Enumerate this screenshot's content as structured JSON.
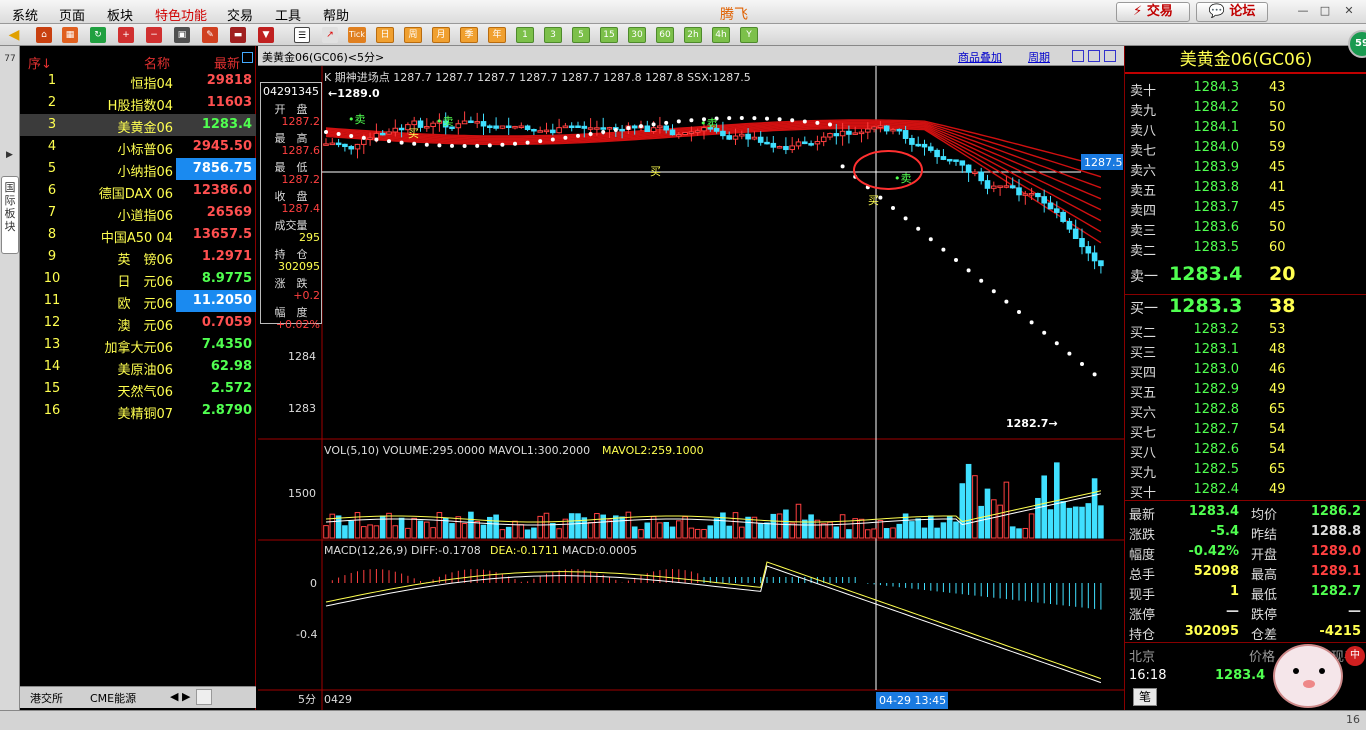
{
  "menu": {
    "items": [
      "系统",
      "页面",
      "板块",
      "特色功能",
      "交易",
      "工具",
      "帮助"
    ],
    "app_title": "腾飞",
    "trade_btn": "交易",
    "forum_btn": "论坛",
    "win_controls": [
      "—",
      "□",
      "✕"
    ]
  },
  "toolbar": {
    "periods": [
      "日",
      "周",
      "月",
      "季",
      "年",
      "1",
      "3",
      "5",
      "15",
      "30",
      "60",
      "2h",
      "4h",
      "Y"
    ],
    "tick_label": "Tick"
  },
  "left_tab": {
    "label": "国际板块",
    "top_label": "77"
  },
  "watchlist": {
    "headers": {
      "no": "序↓",
      "name": "名称",
      "price": "最新"
    },
    "rows": [
      {
        "no": "1",
        "name": "恒指04",
        "price": "29818",
        "color": "red"
      },
      {
        "no": "2",
        "name": "H股指数04",
        "price": "11603",
        "color": "red"
      },
      {
        "no": "3",
        "name": "美黄金06",
        "price": "1283.4",
        "color": "green",
        "selected": true
      },
      {
        "no": "4",
        "name": "小标普06",
        "price": "2945.50",
        "color": "red"
      },
      {
        "no": "5",
        "name": "小纳指06",
        "price": "7856.75",
        "color": "hl"
      },
      {
        "no": "6",
        "name": "德国DAX 06",
        "price": "12386.0",
        "color": "red"
      },
      {
        "no": "7",
        "name": "小道指06",
        "price": "26569",
        "color": "red"
      },
      {
        "no": "8",
        "name": "中国A50 04",
        "price": "13657.5",
        "color": "red"
      },
      {
        "no": "9",
        "name": "英　镑06",
        "price": "1.2971",
        "color": "red"
      },
      {
        "no": "10",
        "name": "日　元06",
        "price": "8.9775",
        "color": "green"
      },
      {
        "no": "11",
        "name": "欧　元06",
        "price": "11.2050",
        "color": "hl"
      },
      {
        "no": "12",
        "name": "澳　元06",
        "price": "0.7059",
        "color": "red"
      },
      {
        "no": "13",
        "name": "加拿大元06",
        "price": "7.4350",
        "color": "green"
      },
      {
        "no": "14",
        "name": "美原油06",
        "price": "62.98",
        "color": "green"
      },
      {
        "no": "15",
        "name": "天然气06",
        "price": "2.572",
        "color": "green"
      },
      {
        "no": "16",
        "name": "美精铜07",
        "price": "2.8790",
        "color": "green"
      }
    ],
    "footer_tabs": [
      "港交所",
      "CME能源"
    ]
  },
  "chart_header": {
    "title": "美黄金06(GC06)<5分>",
    "overlay_link": "商品叠加",
    "period_link": "周期"
  },
  "kline": {
    "indicator_label": "K  期神进场点  1287.7  1287.7  1287.7  1287.7  1287.7  1287.8  1287.8  SSX:1287.5",
    "high_marker": "1289.0",
    "low_marker": "1282.7",
    "price_tag": "1287.5",
    "y_ticks": [
      "1284",
      "1283"
    ],
    "signal_sell": "卖",
    "signal_buy": "买"
  },
  "infobox": {
    "time": "04291345",
    "labels": [
      "开　盘",
      "最　高",
      "最　低",
      "收　盘",
      "成交量",
      "持　仓",
      "涨　跌",
      "幅　度"
    ],
    "values": [
      "1287.2",
      "1287.6",
      "1287.2",
      "1287.4",
      "295",
      "302095",
      "+0.2",
      "+0.02%"
    ]
  },
  "volume": {
    "label": "VOL(5,10)  VOLUME:295.0000  MAVOL1:300.2000",
    "label2": "MAVOL2:259.1000",
    "y_tick": "1500"
  },
  "macd": {
    "label": "MACD(12,26,9)  DIFF:-0.1708",
    "dea": "DEA:-0.1711",
    "macd_val": "MACD:0.0005",
    "y_ticks": [
      "0",
      "-0.4"
    ]
  },
  "xaxis": {
    "period": "5分",
    "start": "0429",
    "cursor_time": "04-29 13:45"
  },
  "orderbook": {
    "title": "美黄金06(GC06)",
    "asks": [
      {
        "label": "卖十",
        "price": "1284.3",
        "vol": "43"
      },
      {
        "label": "卖九",
        "price": "1284.2",
        "vol": "50"
      },
      {
        "label": "卖八",
        "price": "1284.1",
        "vol": "50"
      },
      {
        "label": "卖七",
        "price": "1284.0",
        "vol": "59"
      },
      {
        "label": "卖六",
        "price": "1283.9",
        "vol": "45"
      },
      {
        "label": "卖五",
        "price": "1283.8",
        "vol": "41"
      },
      {
        "label": "卖四",
        "price": "1283.7",
        "vol": "45"
      },
      {
        "label": "卖三",
        "price": "1283.6",
        "vol": "50"
      },
      {
        "label": "卖二",
        "price": "1283.5",
        "vol": "60"
      },
      {
        "label": "卖一",
        "price": "1283.4",
        "vol": "20"
      }
    ],
    "bids": [
      {
        "label": "买一",
        "price": "1283.3",
        "vol": "38"
      },
      {
        "label": "买二",
        "price": "1283.2",
        "vol": "53"
      },
      {
        "label": "买三",
        "price": "1283.1",
        "vol": "48"
      },
      {
        "label": "买四",
        "price": "1283.0",
        "vol": "46"
      },
      {
        "label": "买五",
        "price": "1282.9",
        "vol": "49"
      },
      {
        "label": "买六",
        "price": "1282.8",
        "vol": "65"
      },
      {
        "label": "买七",
        "price": "1282.7",
        "vol": "54"
      },
      {
        "label": "买八",
        "price": "1282.6",
        "vol": "54"
      },
      {
        "label": "买九",
        "price": "1282.5",
        "vol": "65"
      },
      {
        "label": "买十",
        "price": "1282.4",
        "vol": "49"
      }
    ],
    "stats": [
      {
        "k1": "最新",
        "v1": "1283.4",
        "c1": "green",
        "k2": "均价",
        "v2": "1286.2",
        "c2": "green"
      },
      {
        "k1": "涨跌",
        "v1": "-5.4",
        "c1": "green",
        "k2": "昨结",
        "v2": "1288.8",
        "c2": "white"
      },
      {
        "k1": "幅度",
        "v1": "-0.42%",
        "c1": "green",
        "k2": "开盘",
        "v2": "1289.0",
        "c2": "red"
      },
      {
        "k1": "总手",
        "v1": "52098",
        "c1": "yellow",
        "k2": "最高",
        "v2": "1289.1",
        "c2": "red"
      },
      {
        "k1": "现手",
        "v1": "1",
        "c1": "yellow",
        "k2": "最低",
        "v2": "1282.7",
        "c2": "green"
      },
      {
        "k1": "涨停",
        "v1": "—",
        "c1": "white",
        "k2": "跌停",
        "v2": "—",
        "c2": "white"
      },
      {
        "k1": "持仓",
        "v1": "302095",
        "c1": "yellow",
        "k2": "仓差",
        "v2": "-4215",
        "c2": "yellow"
      }
    ],
    "tick_header": {
      "loc": "北京",
      "price": "价格",
      "vol": "现手"
    },
    "tick_row": {
      "time": "16:18",
      "price": "1283.4"
    },
    "tab": "笔"
  },
  "badge": "59",
  "status": {
    "right": "16"
  },
  "colors": {
    "up": "#ff4040",
    "down": "#40e0ff",
    "green": "#50ff50",
    "yellow": "#ffff50",
    "accent": "#c00000"
  }
}
